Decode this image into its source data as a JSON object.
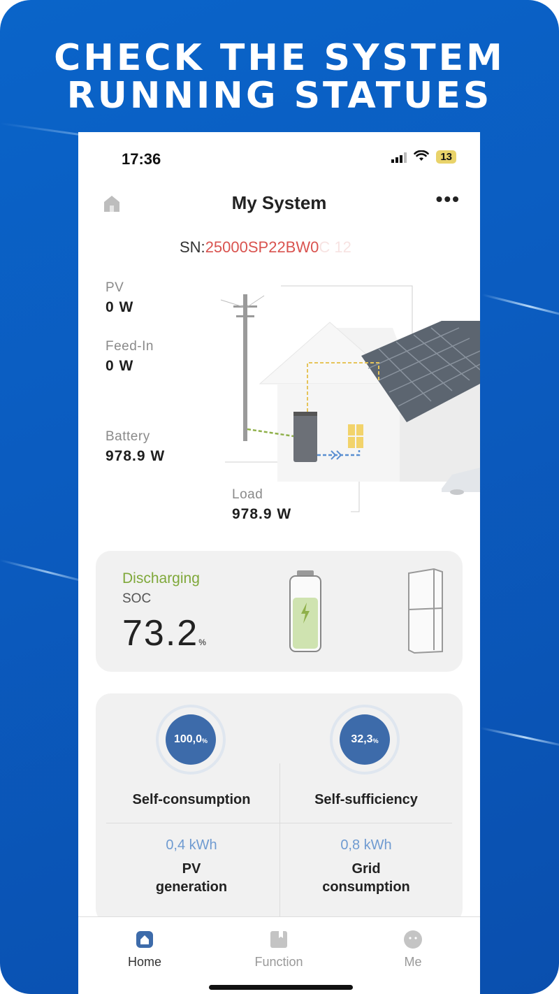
{
  "promo": {
    "headline_line1": "CHECK THE SYSTEM",
    "headline_line2": "RUNNING STATUES"
  },
  "status_bar": {
    "time": "17:36",
    "battery_level": "13",
    "icons": [
      "signal-icon",
      "wifi-icon",
      "battery-icon"
    ]
  },
  "header": {
    "title": "My System",
    "home_icon": "home-icon",
    "more_icon": "more-icon"
  },
  "device": {
    "sn_prefix": "SN:",
    "sn_value": "25000SP22BW0",
    "sn_obscured": "C 12"
  },
  "energy_flow": {
    "pv_label": "PV",
    "pv_value": "0 W",
    "feedin_label": "Feed-In",
    "feedin_value": "0 W",
    "battery_label": "Battery",
    "battery_value": "978.9 W",
    "load_label": "Load",
    "load_value": "978.9 W"
  },
  "battery_card": {
    "status": "Discharging",
    "soc_label": "SOC",
    "soc_value": "73.2",
    "soc_unit": "%",
    "level": 0.732
  },
  "stats_card": {
    "self_consumption_pct": "100,0",
    "self_sufficiency_pct": "32,3",
    "pct_unit": "%",
    "self_consumption_label": "Self-consumption",
    "self_sufficiency_label": "Self-sufficiency",
    "pv_kwh": "0,4 kWh",
    "pv_label_line1": "PV",
    "pv_label_line2": "generation",
    "grid_kwh": "0,8 kWh",
    "grid_label_line1": "Grid",
    "grid_label_line2": "consumption"
  },
  "tabbar": {
    "home": "Home",
    "function": "Function",
    "me": "Me",
    "active": "Home"
  },
  "colors": {
    "promo_blue": "#0a5cc0",
    "accent_blue": "#3d6baa",
    "discharge_green": "#7fa83a",
    "sn_red": "#d9534f",
    "kwh_blue": "#6f9bd1"
  }
}
